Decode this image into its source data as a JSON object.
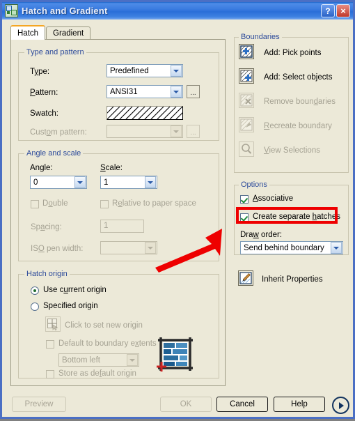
{
  "window": {
    "title": "Hatch and Gradient",
    "icon": "autocad-hatch-icon",
    "help_button": "?",
    "close_button": "×",
    "accent_title_bar": "#2a6ed8",
    "accent_group_label": "#2c4a9a",
    "highlight_color": "#ee0000"
  },
  "tabs": [
    {
      "label": "Hatch",
      "active": true
    },
    {
      "label": "Gradient",
      "active": false
    }
  ],
  "type_and_pattern": {
    "group_label": "Type and pattern",
    "type_label": "Type:",
    "type_value": "Predefined",
    "pattern_label": "Pattern:",
    "pattern_value": "ANSI31",
    "pattern_browse": "...",
    "swatch_label": "Swatch:",
    "swatch_pattern": "ansi31-diagonal-hatch",
    "custom_pattern_label": "Custom pattern:",
    "custom_pattern_value": "",
    "custom_pattern_browse": "...",
    "custom_pattern_enabled": false
  },
  "angle_and_scale": {
    "group_label": "Angle and scale",
    "angle_label": "Angle:",
    "angle_value": "0",
    "scale_label": "Scale:",
    "scale_value": "1",
    "double_label": "Double",
    "double_checked": false,
    "double_enabled": false,
    "relative_label": "Relative to paper space",
    "relative_checked": false,
    "relative_enabled": false,
    "spacing_label": "Spacing:",
    "spacing_value": "1",
    "spacing_enabled": false,
    "iso_label": "ISO pen width:",
    "iso_value": "",
    "iso_enabled": false
  },
  "hatch_origin": {
    "group_label": "Hatch origin",
    "use_current_label": "Use current origin",
    "use_current_selected": true,
    "specified_label": "Specified origin",
    "specified_selected": false,
    "click_set_label": "Click to set new origin",
    "click_set_enabled": false,
    "default_extents_label": "Default to boundary extents",
    "default_extents_checked": false,
    "default_extents_enabled": false,
    "extents_corner_value": "Bottom left",
    "extents_corner_enabled": false,
    "store_default_label": "Store as default origin",
    "store_default_checked": false,
    "store_default_enabled": false,
    "preview_image": "brick-wall-origin-preview"
  },
  "boundaries": {
    "group_label": "Boundaries",
    "items": [
      {
        "label": "Add: Pick points",
        "icon": "pick-points-icon",
        "enabled": true
      },
      {
        "label": "Add: Select objects",
        "icon": "select-objects-icon",
        "enabled": true
      },
      {
        "label": "Remove boundaries",
        "icon": "remove-boundaries-icon",
        "enabled": false
      },
      {
        "label": "Recreate boundary",
        "icon": "recreate-boundary-icon",
        "enabled": false
      },
      {
        "label": "View Selections",
        "icon": "magnifier-icon",
        "enabled": false
      }
    ]
  },
  "options": {
    "group_label": "Options",
    "associative_label": "Associative",
    "associative_checked": true,
    "separate_hatches_label": "Create separate hatches",
    "separate_hatches_checked": true,
    "separate_hatches_highlighted": true,
    "draw_order_label": "Draw order:",
    "draw_order_value": "Send behind boundary",
    "inherit_label": "Inherit Properties",
    "inherit_icon": "paintbrush-icon"
  },
  "footer": {
    "preview_label": "Preview",
    "preview_enabled": false,
    "ok_label": "OK",
    "ok_enabled": false,
    "cancel_label": "Cancel",
    "help_label": "Help",
    "expand_icon": "expand-arrow-icon"
  }
}
